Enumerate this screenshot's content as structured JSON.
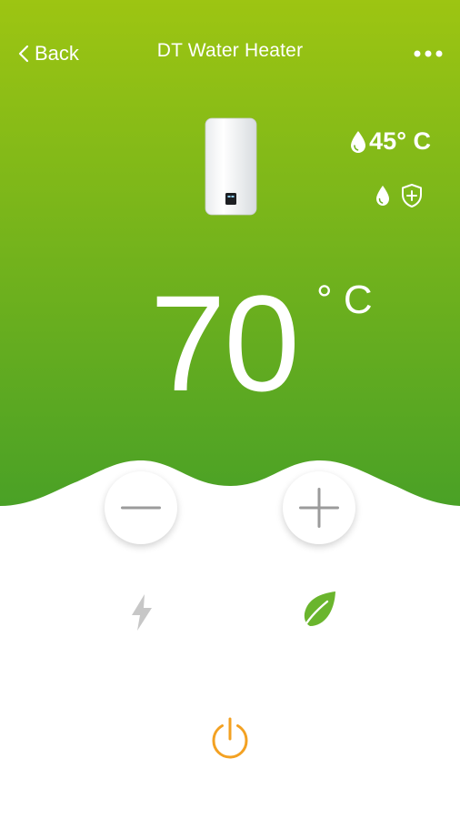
{
  "nav": {
    "back_label": "Back",
    "title": "DT Water Heater",
    "more_icon": "more-horizontal-icon"
  },
  "status": {
    "water_temp": "45° C",
    "water_drop_icon": "water-drop-icon",
    "protection_icon": "shield-plus-icon"
  },
  "setpoint": {
    "value": "70",
    "unit": "° C"
  },
  "controls": {
    "decrease_icon": "minus-icon",
    "increase_icon": "plus-icon",
    "boost_icon": "lightning-icon",
    "eco_icon": "leaf-icon",
    "power_icon": "power-icon"
  },
  "colors": {
    "gradient_top": "#9dc512",
    "gradient_bottom": "#4aa126",
    "eco_active": "#6ab52d",
    "boost_inactive": "#c7c7c7",
    "power": "#f3a122",
    "control_gray": "#9b9b9b"
  }
}
